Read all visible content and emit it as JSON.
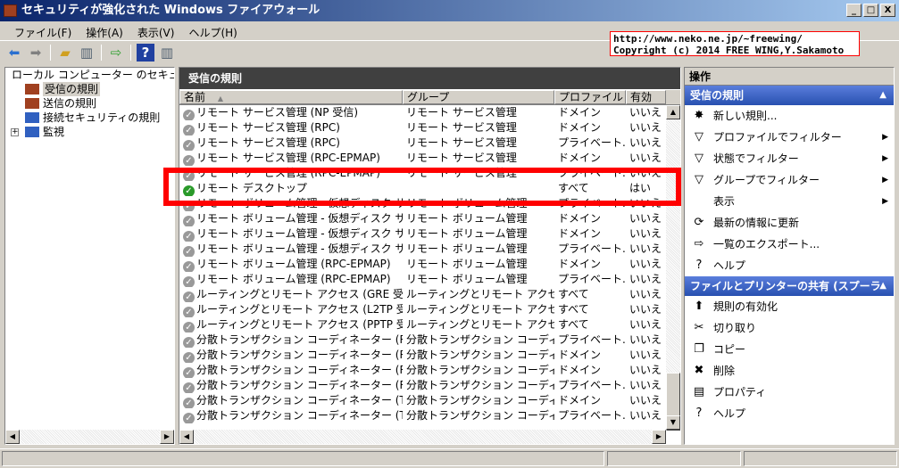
{
  "window": {
    "title": "セキュリティが強化された Windows ファイアウォール",
    "minimize": "_",
    "maximize": "□",
    "close": "X"
  },
  "menu": [
    "ファイル(F)",
    "操作(A)",
    "表示(V)",
    "ヘルプ(H)"
  ],
  "overlay": {
    "line1": "http://www.neko.ne.jp/~freewing/",
    "line2": "Copyright (c) 2014 FREE WING,Y.Sakamoto"
  },
  "tree": {
    "root": "ローカル コンピューター のセキュリティ",
    "items": [
      "受信の規則",
      "送信の規則",
      "接続セキュリティの規則",
      "監視"
    ]
  },
  "middle": {
    "title": "受信の規則",
    "columns": [
      "名前",
      "グループ",
      "プロファイル",
      "有効"
    ],
    "rows": [
      [
        "リモート サービス管理 (NP 受信)",
        "リモート サービス管理",
        "ドメイン",
        "いいえ"
      ],
      [
        "リモート サービス管理 (RPC)",
        "リモート サービス管理",
        "ドメイン",
        "いいえ"
      ],
      [
        "リモート サービス管理 (RPC)",
        "リモート サービス管理",
        "プライベート...",
        "いいえ"
      ],
      [
        "リモート サービス管理 (RPC-EPMAP)",
        "リモート サービス管理",
        "ドメイン",
        "いいえ"
      ],
      [
        "リモート サービス管理 (RPC-EPMAP)",
        "リモート サービス管理",
        "プライベート...",
        "いいえ"
      ],
      [
        "リモート デスクトップ",
        "",
        "すべて",
        "はい"
      ],
      [
        "リモート ボリューム管理 - 仮想ディスク サービス...",
        "リモート ボリューム管理",
        "プライベート...",
        "いいえ"
      ],
      [
        "リモート ボリューム管理 - 仮想ディスク サービス...",
        "リモート ボリューム管理",
        "ドメイン",
        "いいえ"
      ],
      [
        "リモート ボリューム管理 - 仮想ディスク サービス...",
        "リモート ボリューム管理",
        "ドメイン",
        "いいえ"
      ],
      [
        "リモート ボリューム管理 - 仮想ディスク サービス...",
        "リモート ボリューム管理",
        "プライベート...",
        "いいえ"
      ],
      [
        "リモート ボリューム管理 (RPC-EPMAP)",
        "リモート ボリューム管理",
        "ドメイン",
        "いいえ"
      ],
      [
        "リモート ボリューム管理 (RPC-EPMAP)",
        "リモート ボリューム管理",
        "プライベート...",
        "いいえ"
      ],
      [
        "ルーティングとリモート アクセス (GRE 受信)",
        "ルーティングとリモート アクセス",
        "すべて",
        "いいえ"
      ],
      [
        "ルーティングとリモート アクセス (L2TP 受信)",
        "ルーティングとリモート アクセス",
        "すべて",
        "いいえ"
      ],
      [
        "ルーティングとリモート アクセス (PPTP 受信)",
        "ルーティングとリモート アクセス",
        "すべて",
        "いいえ"
      ],
      [
        "分散トランザクション コーディネーター (RPC)",
        "分散トランザクション コーディネー...",
        "プライベート...",
        "いいえ"
      ],
      [
        "分散トランザクション コーディネーター (RPC)",
        "分散トランザクション コーディネー...",
        "ドメイン",
        "いいえ"
      ],
      [
        "分散トランザクション コーディネーター (RPC-EP...",
        "分散トランザクション コーディネー...",
        "ドメイン",
        "いいえ"
      ],
      [
        "分散トランザクション コーディネーター (RPC-EP...",
        "分散トランザクション コーディネー...",
        "プライベート...",
        "いいえ"
      ],
      [
        "分散トランザクション コーディネーター (TCP 受...",
        "分散トランザクション コーディネー...",
        "ドメイン",
        "いいえ"
      ],
      [
        "分散トランザクション コーディネーター (TCP 受...",
        "分散トランザクション コーディネー...",
        "プライベート...",
        "いいえ"
      ]
    ],
    "enabled_index": 5
  },
  "actions": {
    "title": "操作",
    "section1": {
      "title": "受信の規則",
      "items": [
        {
          "label": "新しい規則...",
          "icon": "new-rule-icon",
          "glyph": "✸"
        },
        {
          "label": "プロファイルでフィルター",
          "icon": "filter-icon",
          "glyph": "▽",
          "sub": true
        },
        {
          "label": "状態でフィルター",
          "icon": "filter-icon",
          "glyph": "▽",
          "sub": true
        },
        {
          "label": "グループでフィルター",
          "icon": "filter-icon",
          "glyph": "▽",
          "sub": true
        },
        {
          "label": "表示",
          "icon": "",
          "glyph": "",
          "sub": true
        },
        {
          "label": "最新の情報に更新",
          "icon": "refresh-icon",
          "glyph": "⟳"
        },
        {
          "label": "一覧のエクスポート...",
          "icon": "export-icon",
          "glyph": "⇨"
        },
        {
          "label": "ヘルプ",
          "icon": "help-icon",
          "glyph": "?"
        }
      ]
    },
    "section2": {
      "title": "ファイルとプリンターの共有 (スプーラー...",
      "items": [
        {
          "label": "規則の有効化",
          "icon": "enable-icon",
          "glyph": "⬆"
        },
        {
          "label": "切り取り",
          "icon": "cut-icon",
          "glyph": "✂"
        },
        {
          "label": "コピー",
          "icon": "copy-icon",
          "glyph": "❐"
        },
        {
          "label": "削除",
          "icon": "delete-icon",
          "glyph": "✖"
        },
        {
          "label": "プロパティ",
          "icon": "properties-icon",
          "glyph": "▤"
        },
        {
          "label": "ヘルプ",
          "icon": "help-icon",
          "glyph": "?"
        }
      ]
    }
  },
  "colors": {
    "highlight": "#ff0000",
    "section": "#3a62c8",
    "enabled": "#2a9a2a"
  }
}
